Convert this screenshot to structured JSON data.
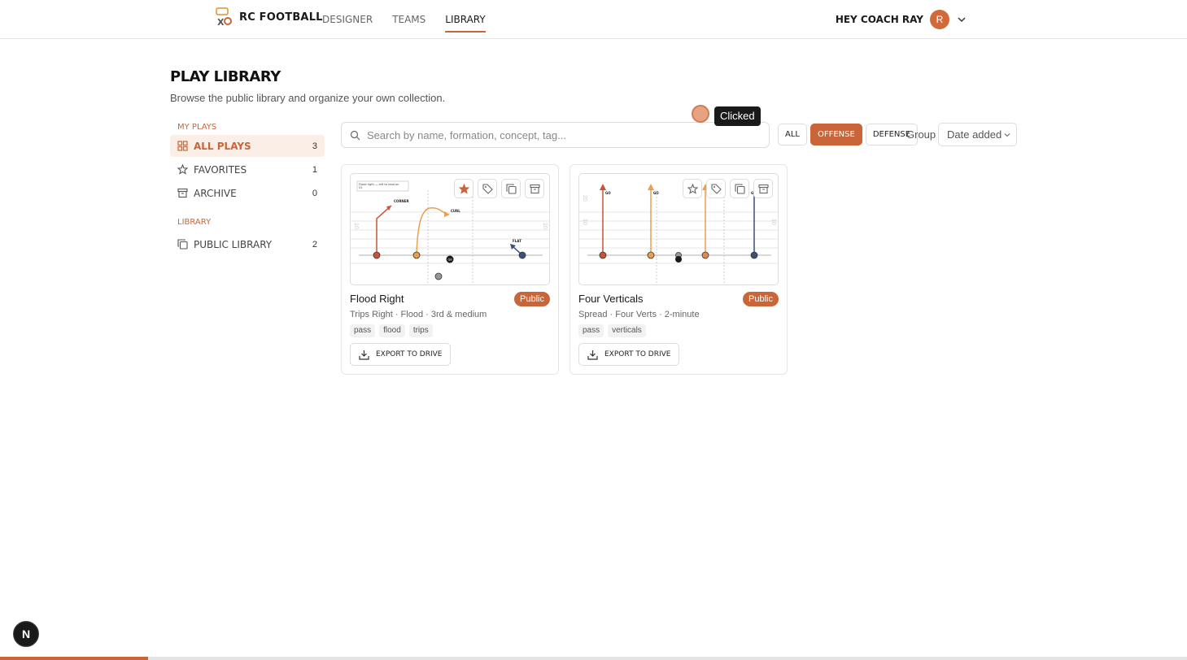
{
  "brand": {
    "name": "RC FOOTBALL"
  },
  "nav": {
    "links": [
      "DESIGNER",
      "TEAMS",
      "LIBRARY"
    ],
    "active": "LIBRARY"
  },
  "user": {
    "greeting": "HEY COACH RAY",
    "initial": "R"
  },
  "page": {
    "title": "PLAY LIBRARY",
    "subtitle": "Browse the public library and organize your own collection."
  },
  "sidebar": {
    "my_plays_label": "MY PLAYS",
    "library_label": "LIBRARY",
    "items": [
      {
        "label": "ALL PLAYS",
        "count": "3",
        "icon": "grid-icon"
      },
      {
        "label": "FAVORITES",
        "count": "1",
        "icon": "star-icon"
      },
      {
        "label": "ARCHIVE",
        "count": "0",
        "icon": "archive-icon"
      },
      {
        "label": "PUBLIC LIBRARY",
        "count": "2",
        "icon": "copy-icon"
      }
    ]
  },
  "search": {
    "placeholder": "Search by name, formation, concept, tag..."
  },
  "filters": {
    "all": "ALL",
    "offense": "OFFENSE",
    "defense": "DEFENSE",
    "active": "OFFENSE"
  },
  "group": {
    "label": "Group",
    "value": "Date added"
  },
  "click_marker": {
    "label": "Clicked"
  },
  "cards": [
    {
      "title": "Flood Right",
      "badge": "Public",
      "meta": "Trips Right · Flood · 3rd & medium",
      "tags": [
        "pass",
        "flood",
        "trips"
      ],
      "export_label": "EXPORT TO DRIVE",
      "favorited": true,
      "diagram": {
        "note": "Flood right — left to read on",
        "routes": [
          "CORNER",
          "CURL",
          "FLAT"
        ],
        "qb": "QB"
      }
    },
    {
      "title": "Four Verticals",
      "badge": "Public",
      "meta": "Spread · Four Verts · 2-minute",
      "tags": [
        "pass",
        "verticals"
      ],
      "export_label": "EXPORT TO DRIVE",
      "favorited": false,
      "diagram": {
        "routes": [
          "GO",
          "GO",
          "GO"
        ]
      }
    }
  ],
  "dev_badge": "N",
  "progress": {
    "fraction": 0.125
  },
  "colors": {
    "accent": "#c8663a",
    "accent_light": "#fbeee6",
    "dark": "#1a1a1a",
    "navy": "#3a4f7a",
    "orange_route": "#e8a04f",
    "red_route": "#c8553a"
  }
}
